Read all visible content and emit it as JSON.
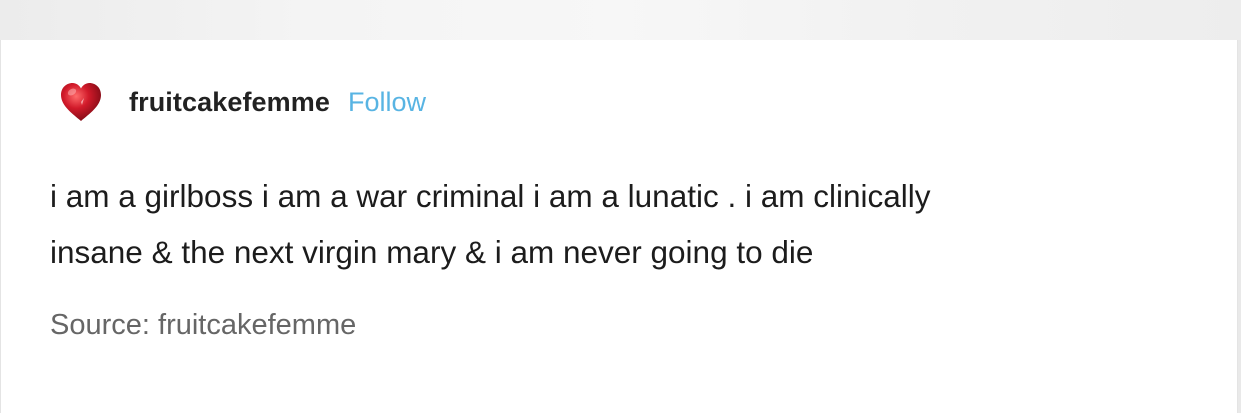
{
  "post": {
    "author": "fruitcakefemme",
    "follow_label": "Follow",
    "body_line_1": "i am a girlboss i am a war criminal i am a lunatic . i am clinically",
    "body_line_2": "insane & the next virgin mary & i am never going to die",
    "source_label": "Source:",
    "source_name": "fruitcakefemme"
  },
  "colors": {
    "follow_link": "#58b4e3",
    "text": "#1c1c1c",
    "muted_text": "#666666",
    "avatar_heart": "#c8102e"
  },
  "icons": {
    "avatar": "red-heart-icon"
  }
}
